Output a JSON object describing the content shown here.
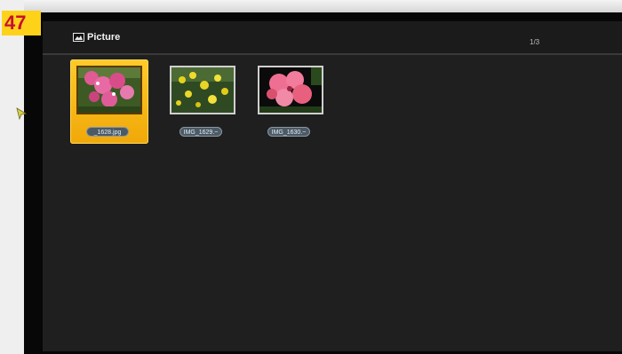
{
  "step_badge": "47",
  "header": {
    "title": "Picture",
    "page_indicator": "1/3",
    "icon": "picture-icon"
  },
  "thumbnails": [
    {
      "filename": "_1628.jpg",
      "selected": true,
      "subject": "pink flowers"
    },
    {
      "filename": "IMG_1629.~",
      "selected": false,
      "subject": "yellow flowers"
    },
    {
      "filename": "IMG_1630.~",
      "selected": false,
      "subject": "pink flowers"
    }
  ],
  "colors": {
    "selection": "#f7b916",
    "screen_bg": "#1f1f1f",
    "badge_bg": "#ffd21a",
    "badge_text": "#c8102e"
  }
}
